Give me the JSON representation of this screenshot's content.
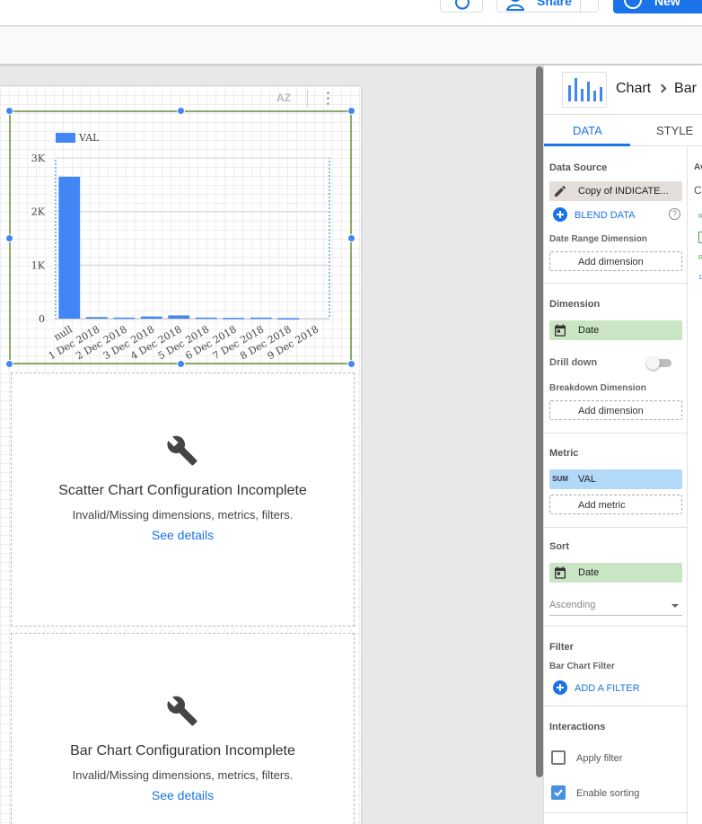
{
  "topbar": {
    "share_label": "Share",
    "new_label": "New"
  },
  "canvas": {
    "sort_label": "AZ",
    "chart": {
      "legend_label": "VAL",
      "y_ticks": [
        "3K",
        "2K",
        "1K",
        "0"
      ],
      "x_labels": [
        "null",
        "1 Dec 2018",
        "2 Dec 2018",
        "3 Dec 2018",
        "4 Dec 2018",
        "5 Dec 2018",
        "6 Dec 2018",
        "7 Dec 2018",
        "8 Dec 2018",
        "9 Dec 2018"
      ]
    },
    "scatter_placeholder": {
      "title": "Scatter Chart Configuration Incomplete",
      "subtitle": "Invalid/Missing dimensions, metrics, filters.",
      "link": "See details"
    },
    "bar_placeholder": {
      "title": "Bar Chart Configuration Incomplete",
      "subtitle": "Invalid/Missing dimensions, metrics, filters.",
      "link": "See details"
    }
  },
  "chart_data": {
    "type": "bar",
    "categories": [
      "null",
      "1 Dec 2018",
      "2 Dec 2018",
      "3 Dec 2018",
      "4 Dec 2018",
      "5 Dec 2018",
      "6 Dec 2018",
      "7 Dec 2018",
      "8 Dec 2018",
      "9 Dec 2018"
    ],
    "series": [
      {
        "name": "VAL",
        "values": [
          2650,
          30,
          20,
          40,
          60,
          20,
          15,
          20,
          10,
          0
        ]
      }
    ],
    "ylim": [
      0,
      3000
    ],
    "y_ticks": [
      0,
      1000,
      2000,
      3000
    ],
    "legend": "top-left",
    "grid": true,
    "colors": {
      "bar": "#4285f4"
    }
  },
  "panel": {
    "header": {
      "title_part1": "Chart",
      "title_part2": "Bar"
    },
    "tabs": {
      "data": "DATA",
      "style": "STYLE"
    },
    "data_source": {
      "title": "Data Source",
      "source_name": "Copy of INDICATE...",
      "blend_label": "BLEND DATA",
      "help": "?",
      "date_range_title": "Date Range Dimension",
      "add_dimension": "Add dimension"
    },
    "dimension": {
      "title": "Dimension",
      "value": "Date",
      "drill_down": "Drill down",
      "breakdown_title": "Breakdown Dimension",
      "add_dimension": "Add dimension"
    },
    "metric": {
      "title": "Metric",
      "agg": "SUM",
      "value": "VAL",
      "add_metric": "Add metric"
    },
    "sort": {
      "title": "Sort",
      "value": "Date",
      "order": "Ascending"
    },
    "filter": {
      "title": "Filter",
      "sub": "Bar Chart Filter",
      "add_filter": "ADD A FILTER"
    },
    "interactions": {
      "title": "Interactions",
      "apply_filter": "Apply filter",
      "enable_sorting": "Enable sorting",
      "apply_filter_checked": false,
      "enable_sorting_checked": true
    },
    "available": {
      "title": "Av",
      "c": "C",
      "r1": "R",
      "r2": "R",
      "n": "1"
    }
  }
}
